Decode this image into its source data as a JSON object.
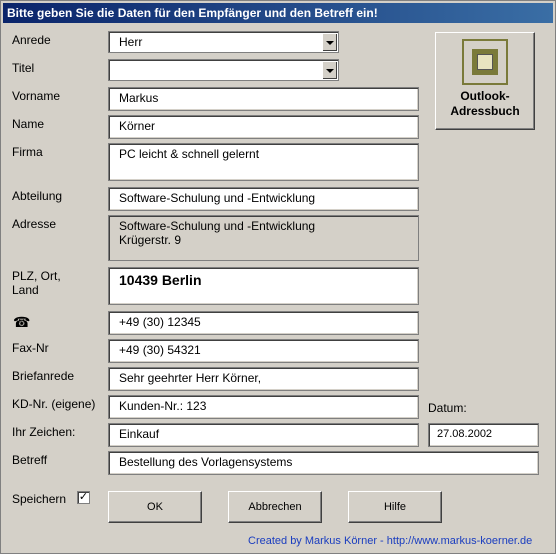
{
  "title": "Bitte geben Sie die Daten für den Empfänger und den Betreff ein!",
  "labels": {
    "anrede": "Anrede",
    "titel": "Titel",
    "vorname": "Vorname",
    "name": "Name",
    "firma": "Firma",
    "abteilung": "Abteilung",
    "adresse": "Adresse",
    "plz": "PLZ, Ort,\nLand",
    "fax": "Fax-Nr",
    "briefanrede": "Briefanrede",
    "kdnr": "KD-Nr. (eigene)",
    "zeichen": "Ihr Zeichen:",
    "betreff": "Betreff",
    "datum": "Datum:",
    "speichern": "Speichern"
  },
  "values": {
    "anrede": "Herr",
    "titel": "",
    "vorname": "Markus",
    "name": "Körner",
    "firma": "PC leicht & schnell gelernt",
    "abteilung": "Software-Schulung und -Entwicklung",
    "adresse": "Software-Schulung und -Entwicklung\nKrügerstr. 9",
    "plz": "10439 Berlin",
    "telefon": "+49 (30) 12345",
    "fax": "+49 (30) 54321",
    "briefanrede": "Sehr geehrter Herr Körner,",
    "kdnr": "Kunden-Nr.: 123",
    "zeichen": "Einkauf",
    "betreff": "Bestellung des Vorlagensystems",
    "datum": "27.08.2002",
    "speichern_checked": "✓"
  },
  "icons": {
    "phone": "☎"
  },
  "buttons": {
    "outlook": "Outlook-\nAdressbuch",
    "ok": "OK",
    "abbrechen": "Abbrechen",
    "hilfe": "Hilfe"
  },
  "footer": "Created by Markus Körner - http://www.markus-koerner.de",
  "colors": {
    "title_start": "#0a246a",
    "title_end": "#3a6ea5",
    "footer": "#1a3dbf"
  }
}
